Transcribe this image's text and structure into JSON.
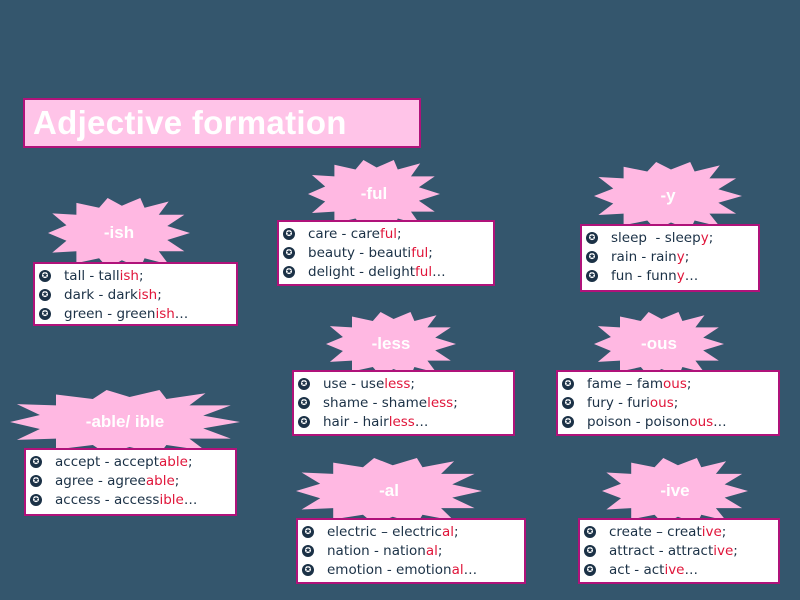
{
  "title": "Adjective formation",
  "colors": {
    "background": "#34566d",
    "title_bg": "#ffc4e8",
    "border": "#b0127a",
    "star": "#ffb8e2",
    "suffix": "#e0153a",
    "text": "#1b3146"
  },
  "groups": [
    {
      "id": "ish",
      "label": "-ish",
      "items": [
        {
          "pre": "tall - tall",
          "suf": "ish",
          "post": ";"
        },
        {
          "pre": "dark - dark",
          "suf": "ish",
          "post": ";"
        },
        {
          "pre": "green - green",
          "suf": "ish",
          "post": "…"
        }
      ]
    },
    {
      "id": "ful",
      "label": "-ful",
      "items": [
        {
          "pre": "care - care",
          "suf": "ful",
          "post": ";"
        },
        {
          "pre": "beauty - beauti",
          "suf": "ful",
          "post": ";"
        },
        {
          "pre": "delight - delight",
          "suf": "ful",
          "post": "…"
        }
      ]
    },
    {
      "id": "y",
      "label": "-y",
      "items": [
        {
          "pre": "sleep  - sleep",
          "suf": "y",
          "post": ";"
        },
        {
          "pre": "rain - rain",
          "suf": "y",
          "post": ";"
        },
        {
          "pre": "fun - funn",
          "suf": "y",
          "post": "…"
        }
      ]
    },
    {
      "id": "less",
      "label": "-less",
      "items": [
        {
          "pre": "use - use",
          "suf": "less",
          "post": ";"
        },
        {
          "pre": "shame - shame",
          "suf": "less",
          "post": ";"
        },
        {
          "pre": "hair - hair",
          "suf": "less",
          "post": "…"
        }
      ]
    },
    {
      "id": "ous",
      "label": "-ous",
      "items": [
        {
          "pre": "fame – fam",
          "suf": "ous",
          "post": ";"
        },
        {
          "pre": "fury - furi",
          "suf": "ous",
          "post": ";"
        },
        {
          "pre": "poison - poison",
          "suf": "ous",
          "post": "…"
        }
      ]
    },
    {
      "id": "able",
      "label": "-able/ ible",
      "items": [
        {
          "pre": "accept - accept",
          "suf": "able",
          "post": ";"
        },
        {
          "pre": "agree - agree",
          "suf": "able",
          "post": ";"
        },
        {
          "pre": "access - access",
          "suf": "ible",
          "post": "…"
        }
      ]
    },
    {
      "id": "al",
      "label": "-al",
      "items": [
        {
          "pre": "electric – electric",
          "suf": "al",
          "post": ";"
        },
        {
          "pre": "nation - nation",
          "suf": "al",
          "post": ";"
        },
        {
          "pre": "emotion - emotion",
          "suf": "al",
          "post": "…"
        }
      ]
    },
    {
      "id": "ive",
      "label": "-ive",
      "items": [
        {
          "pre": "create – creat",
          "suf": "ive",
          "post": ";"
        },
        {
          "pre": "attract - attract",
          "suf": "ive",
          "post": ";"
        },
        {
          "pre": "act - act",
          "suf": "ive",
          "post": "…"
        }
      ]
    }
  ]
}
